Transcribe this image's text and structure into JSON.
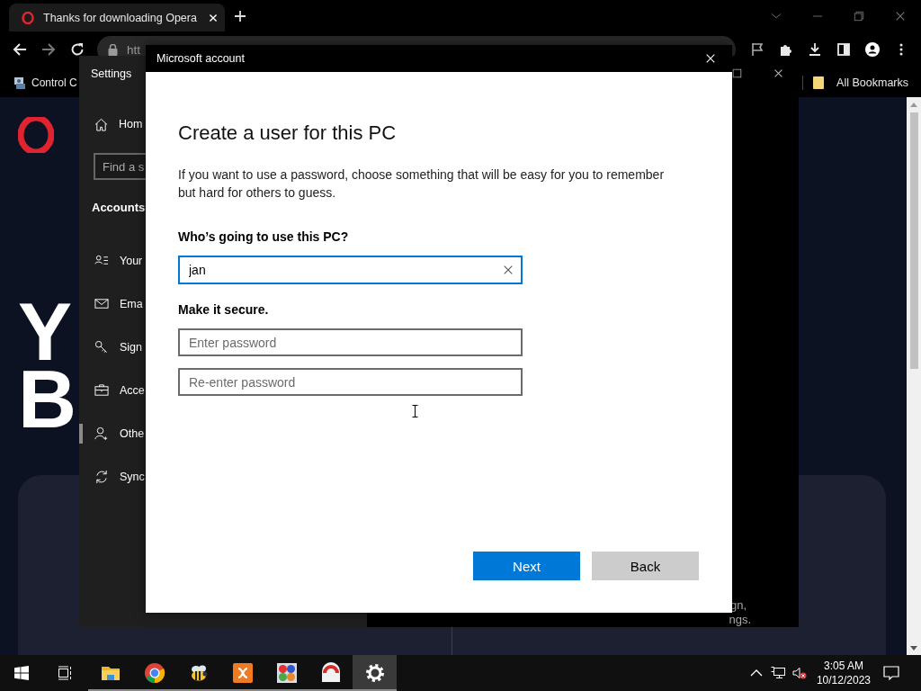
{
  "browser": {
    "tab": {
      "title": "Thanks for downloading Opera"
    },
    "address": {
      "text": "htt"
    },
    "bookmarks": [
      {
        "kind": "app",
        "label": "Control C"
      },
      {
        "kind": "folder",
        "label": "All Bookmarks"
      }
    ]
  },
  "page": {
    "hero_lines": [
      "Y",
      "B"
    ]
  },
  "settings": {
    "title": "Settings",
    "home": {
      "label": "Hom"
    },
    "search": {
      "placeholder": "Find a s"
    },
    "section": "Accounts",
    "items": [
      {
        "kind": "info",
        "label": "Your",
        "selected": false
      },
      {
        "kind": "mail",
        "label": "Ema",
        "selected": false
      },
      {
        "kind": "key",
        "label": "Sign",
        "selected": false
      },
      {
        "kind": "work",
        "label": "Acce",
        "selected": false
      },
      {
        "kind": "add-user",
        "label": "Othe",
        "selected": true
      },
      {
        "kind": "sync",
        "label": "Sync",
        "selected": false
      }
    ],
    "fragments": [
      "gn,",
      "ngs."
    ]
  },
  "dialog": {
    "title": "Microsoft account",
    "heading": "Create a user for this PC",
    "description": "If you want to use a password, choose something that will be easy for you to remember but hard for others to guess.",
    "user_label": "Who’s going to use this PC?",
    "user_field": {
      "value": "jan"
    },
    "secure_label": "Make it secure.",
    "password_fields": [
      {
        "placeholder": "Enter password"
      },
      {
        "placeholder": "Re-enter password"
      }
    ],
    "buttons": [
      {
        "kind": "primary",
        "label": "Next"
      },
      {
        "kind": "secondary",
        "label": "Back"
      }
    ]
  },
  "taskbar": {
    "apps": [
      {
        "kind": "folder",
        "running": true,
        "active": false
      },
      {
        "kind": "round",
        "running": true,
        "active": false
      },
      {
        "kind": "bee",
        "running": true,
        "active": false
      },
      {
        "kind": "tile",
        "running": true,
        "active": false
      },
      {
        "kind": "dots",
        "running": true,
        "active": false
      },
      {
        "kind": "gauge",
        "running": true,
        "active": false
      },
      {
        "kind": "gear",
        "running": true,
        "active": true
      }
    ],
    "time": "3:05 AM",
    "date": "10/12/2023"
  }
}
